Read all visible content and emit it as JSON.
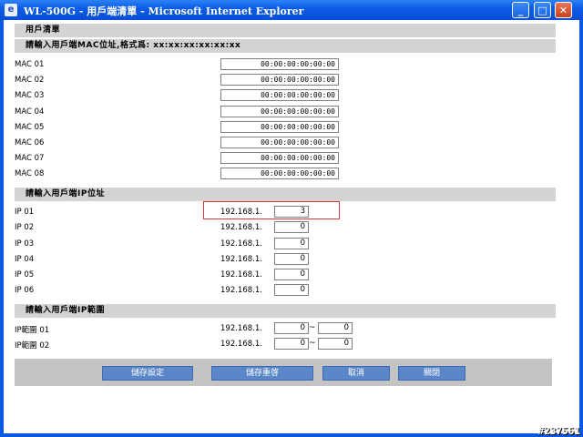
{
  "window": {
    "title": "WL-500G - 用戶端清單 - Microsoft Internet Explorer",
    "min_glyph": "_",
    "max_glyph": "□",
    "close_glyph": "✕"
  },
  "page": {
    "title": "用戶清單"
  },
  "mac_section": {
    "heading": "請輸入用戶端MAC位址,格式爲: xx:xx:xx:xx:xx:xx",
    "rows": [
      {
        "label": "MAC 01",
        "value": "00:00:00:00:00:00"
      },
      {
        "label": "MAC 02",
        "value": "00:00:00:00:00:00"
      },
      {
        "label": "MAC 03",
        "value": "00:00:00:00:00:00"
      },
      {
        "label": "MAC 04",
        "value": "00:00:00:00:00:00"
      },
      {
        "label": "MAC 05",
        "value": "00:00:00:00:00:00"
      },
      {
        "label": "MAC 06",
        "value": "00:00:00:00:00:00"
      },
      {
        "label": "MAC 07",
        "value": "00:00:00:00:00:00"
      },
      {
        "label": "MAC 08",
        "value": "00:00:00:00:00:00"
      }
    ]
  },
  "ip_section": {
    "heading": "請輸入用戶端IP位址",
    "prefix": "192.168.1.",
    "rows": [
      {
        "label": "IP 01",
        "value": "3"
      },
      {
        "label": "IP 02",
        "value": "0"
      },
      {
        "label": "IP 03",
        "value": "0"
      },
      {
        "label": "IP 04",
        "value": "0"
      },
      {
        "label": "IP 05",
        "value": "0"
      },
      {
        "label": "IP 06",
        "value": "0"
      }
    ]
  },
  "range_section": {
    "heading": "請輸入用戶端IP範圍",
    "prefix": "192.168.1.",
    "separator": "~",
    "rows": [
      {
        "label": "IP範圍 01",
        "from": "0",
        "to": "0"
      },
      {
        "label": "IP範圍 02",
        "from": "0",
        "to": "0"
      }
    ]
  },
  "buttons": {
    "save_settings": "儲存設定",
    "save_restart": "儲存重啓",
    "cancel": "取消",
    "close": "關閉"
  },
  "watermark": "#237561",
  "colors": {
    "titlebar": "#0b5ce8",
    "section_bg": "#d3d3d3",
    "button": "#5b87c9",
    "highlight": "#d43a3a"
  }
}
